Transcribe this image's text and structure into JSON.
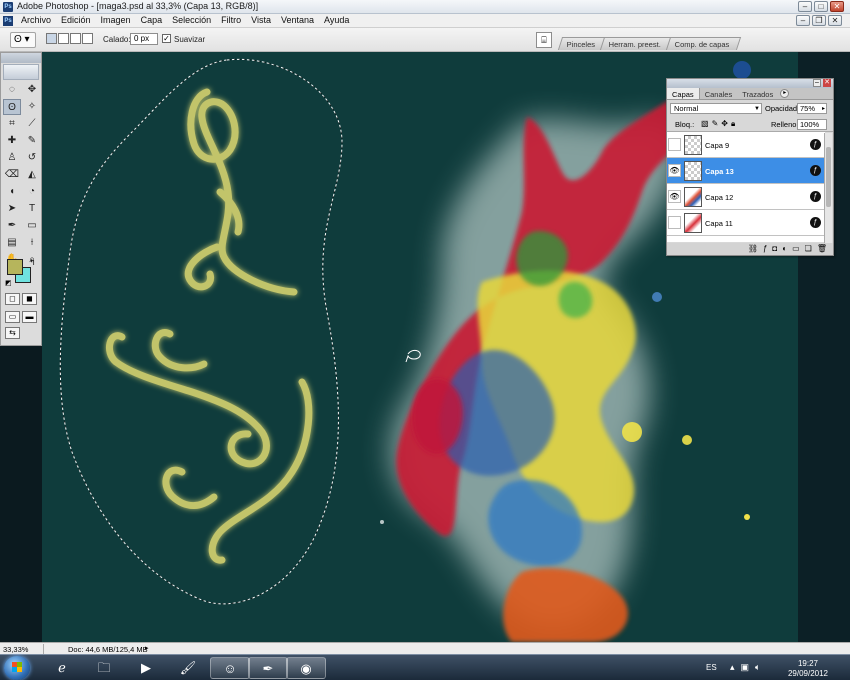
{
  "window": {
    "app_icon": "Ps",
    "title": "Adobe Photoshop - [maga3.psd al 33,3% (Capa 13, RGB/8)]"
  },
  "menu": {
    "items": [
      "Archivo",
      "Edición",
      "Imagen",
      "Capa",
      "Selección",
      "Filtro",
      "Vista",
      "Ventana",
      "Ayuda"
    ]
  },
  "options": {
    "tool_icon": "lasso-icon",
    "feather_label": "Calado:",
    "feather_value": "0 px",
    "antialias_label": "Suavizar",
    "antialias_checked": true,
    "dock_tabs": [
      "Pinceles",
      "Herram. preest.",
      "Comp. de capas"
    ]
  },
  "tools": {
    "fg_color": "#b6b55c",
    "bg_color": "#6fe2df"
  },
  "layers_panel": {
    "tabs": [
      "Capas",
      "Canales",
      "Trazados"
    ],
    "blend_mode": "Normal",
    "opacity_label": "Opacidad:",
    "opacity_value": "75%",
    "lock_label": "Bloq.:",
    "fill_label": "Relleno:",
    "fill_value": "100%",
    "layers": [
      {
        "name": "Capa 9",
        "visible": false,
        "selected": false
      },
      {
        "name": "Capa 13",
        "visible": true,
        "selected": true
      },
      {
        "name": "Capa 12",
        "visible": true,
        "selected": false
      },
      {
        "name": "Capa 11",
        "visible": false,
        "selected": false
      }
    ]
  },
  "status": {
    "zoom": "33,33%",
    "doc": "Doc: 44,6 MB/125,4 MB"
  },
  "taskbar": {
    "lang": "ES",
    "time": "19:27",
    "date": "29/09/2012"
  },
  "colors": {
    "canvas_bg": "#0f3c3c",
    "ornament": "#c2c46a",
    "selection_accent": "#3d8ee6"
  }
}
